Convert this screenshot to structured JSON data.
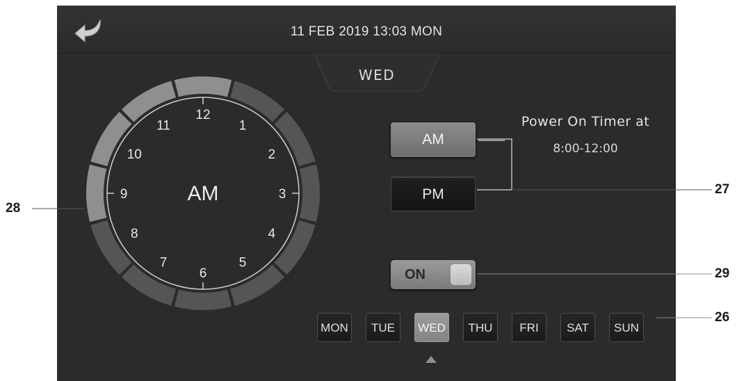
{
  "header": {
    "datetime": "11 FEB 2019 13:03 MON"
  },
  "day_tab": {
    "label": "WED"
  },
  "clock": {
    "center_label": "AM",
    "hour_numbers": [
      "12",
      "1",
      "2",
      "3",
      "4",
      "5",
      "6",
      "7",
      "8",
      "9",
      "10",
      "11"
    ],
    "segments_on": [
      true,
      false,
      false,
      false,
      false,
      false,
      false,
      false,
      false,
      true,
      true,
      true
    ],
    "ring_segment_count": 12,
    "on_color": "#8f8f8f",
    "off_color": "#555555"
  },
  "ampm": {
    "am_label": "AM",
    "pm_label": "PM",
    "selected": "AM"
  },
  "timer": {
    "title": "Power On Timer at",
    "range": "8:00-12:00"
  },
  "toggle": {
    "label": "ON",
    "state": "on"
  },
  "days": {
    "items": [
      "MON",
      "TUE",
      "WED",
      "THU",
      "FRI",
      "SAT",
      "SUN"
    ],
    "selected": "WED"
  },
  "callouts": {
    "c26": "26",
    "c27": "27",
    "c28": "28",
    "c29": "29"
  }
}
